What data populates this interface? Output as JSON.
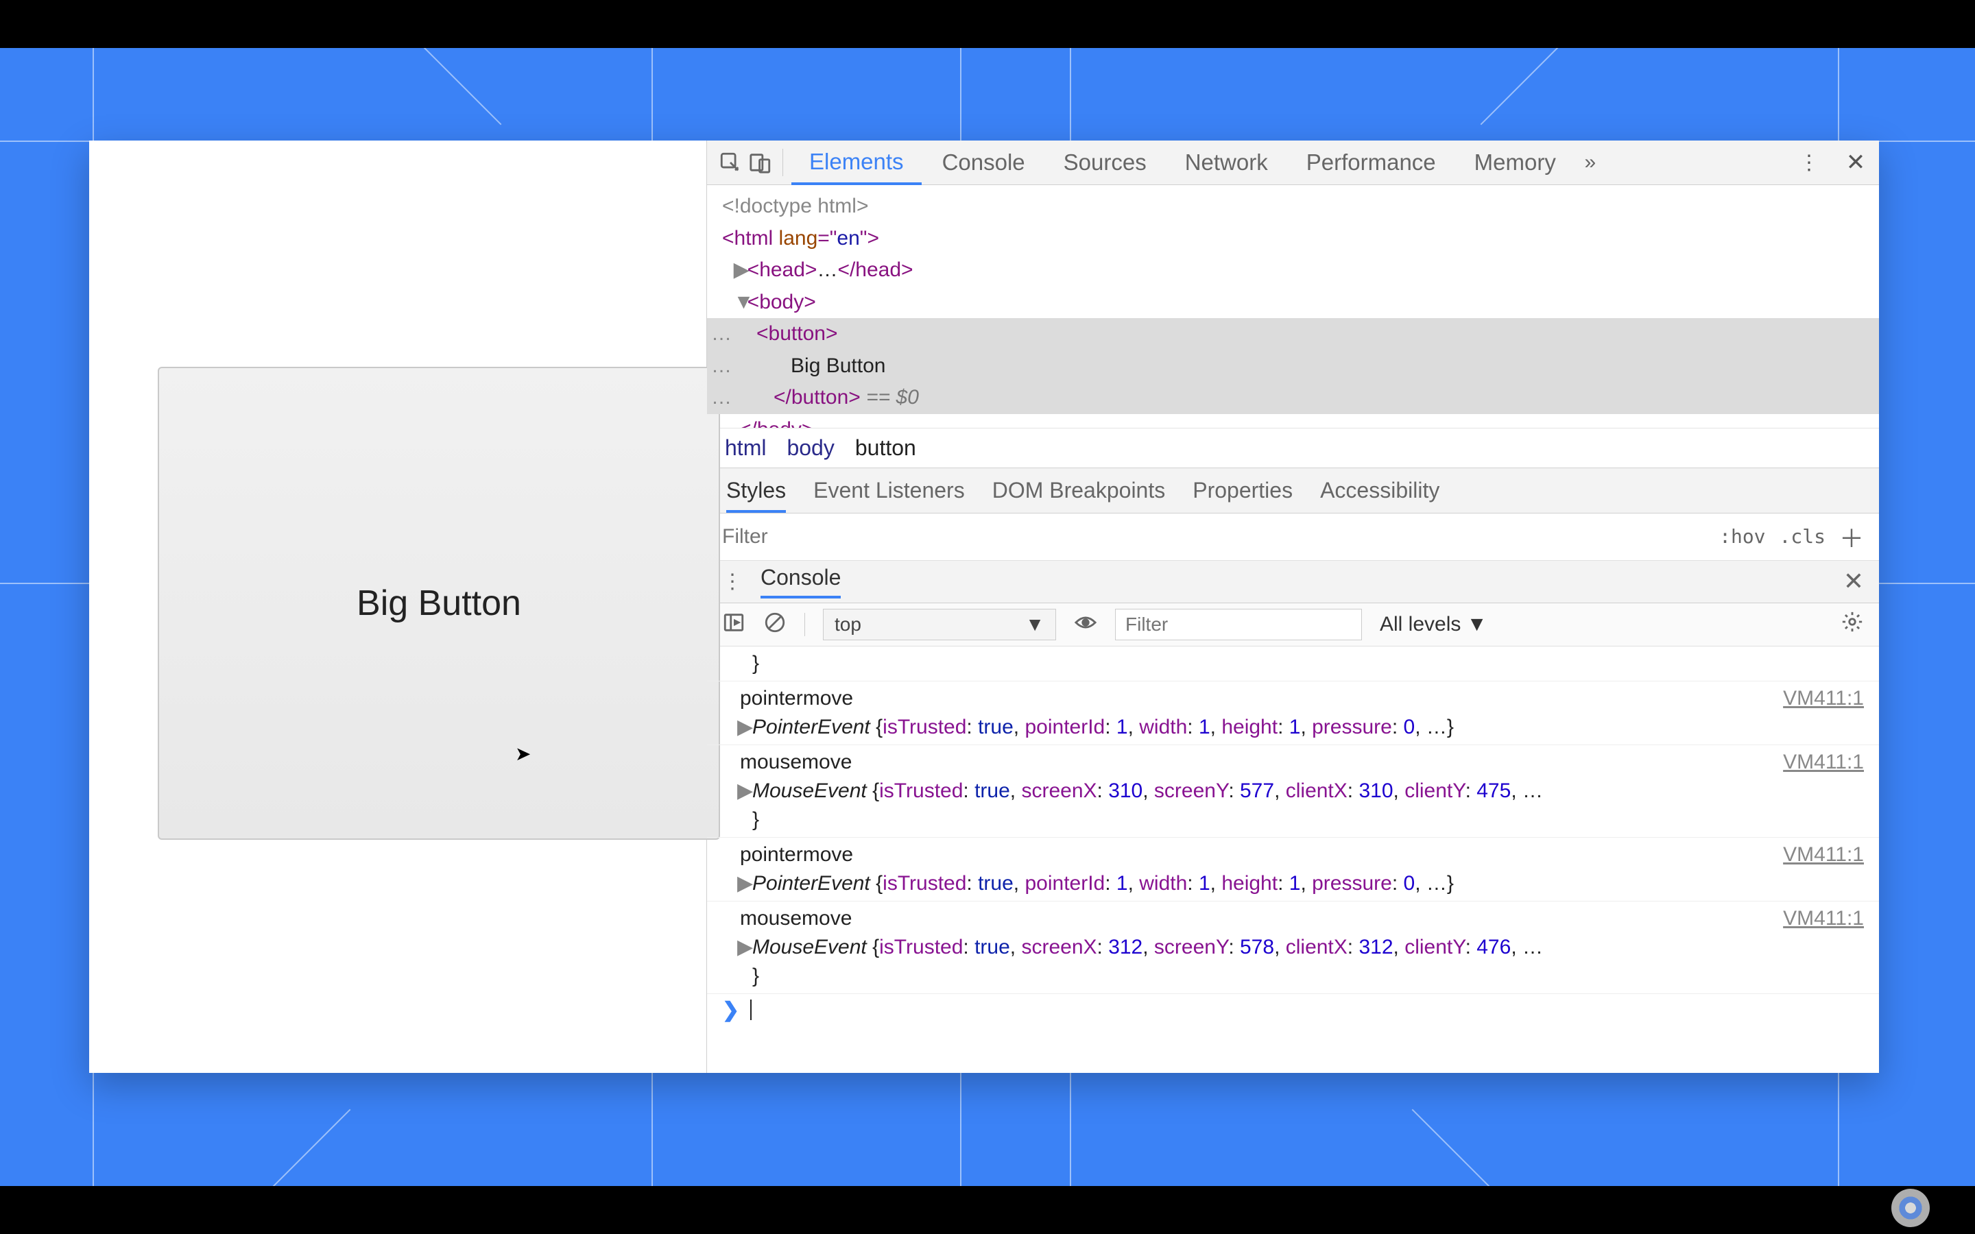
{
  "page": {
    "button_label": "Big Button"
  },
  "devtools": {
    "tabs": [
      "Elements",
      "Console",
      "Sources",
      "Network",
      "Performance",
      "Memory"
    ],
    "active_tab": "Elements",
    "dom": {
      "doctype": "<!doctype html>",
      "html_open": "<html lang=\"en\">",
      "head": "<head>…</head>",
      "body_open": "<body>",
      "btn_open": "<button>",
      "btn_text": "Big Button",
      "btn_close": "</button>",
      "ref": " == $0",
      "body_close": "</body>"
    },
    "breadcrumb": [
      "html",
      "body",
      "button"
    ],
    "sub_tabs": [
      "Styles",
      "Event Listeners",
      "DOM Breakpoints",
      "Properties",
      "Accessibility"
    ],
    "active_sub_tab": "Styles",
    "styles": {
      "filter_placeholder": "Filter",
      "hov": ":hov",
      "cls": ".cls"
    },
    "drawer": {
      "title": "Console"
    },
    "console": {
      "context": "top",
      "filter_placeholder": "Filter",
      "levels": "All levels ▼",
      "residual": "}",
      "logs": [
        {
          "label": "pointermove",
          "src": "VM411:1",
          "cls": "PointerEvent",
          "props": "{isTrusted: true, pointerId: 1, width: 1, height: 1, pressure: 0, …}"
        },
        {
          "label": "mousemove",
          "src": "VM411:1",
          "cls": "MouseEvent",
          "props_parts": [
            "{",
            "isTrusted:",
            " true",
            ", ",
            "screenX:",
            " 310",
            ", ",
            "screenY:",
            " 577",
            ", ",
            "clientX:",
            " 310",
            ", ",
            "clientY:",
            " 475",
            ", …\n}"
          ]
        },
        {
          "label": "pointermove",
          "src": "VM411:1",
          "cls": "PointerEvent",
          "props": "{isTrusted: true, pointerId: 1, width: 1, height: 1, pressure: 0, …}"
        },
        {
          "label": "mousemove",
          "src": "VM411:1",
          "cls": "MouseEvent",
          "props_parts": [
            "{",
            "isTrusted:",
            " true",
            ", ",
            "screenX:",
            " 312",
            ", ",
            "screenY:",
            " 578",
            ", ",
            "clientX:",
            " 312",
            ", ",
            "clientY:",
            " 476",
            ", …\n}"
          ]
        }
      ]
    }
  }
}
